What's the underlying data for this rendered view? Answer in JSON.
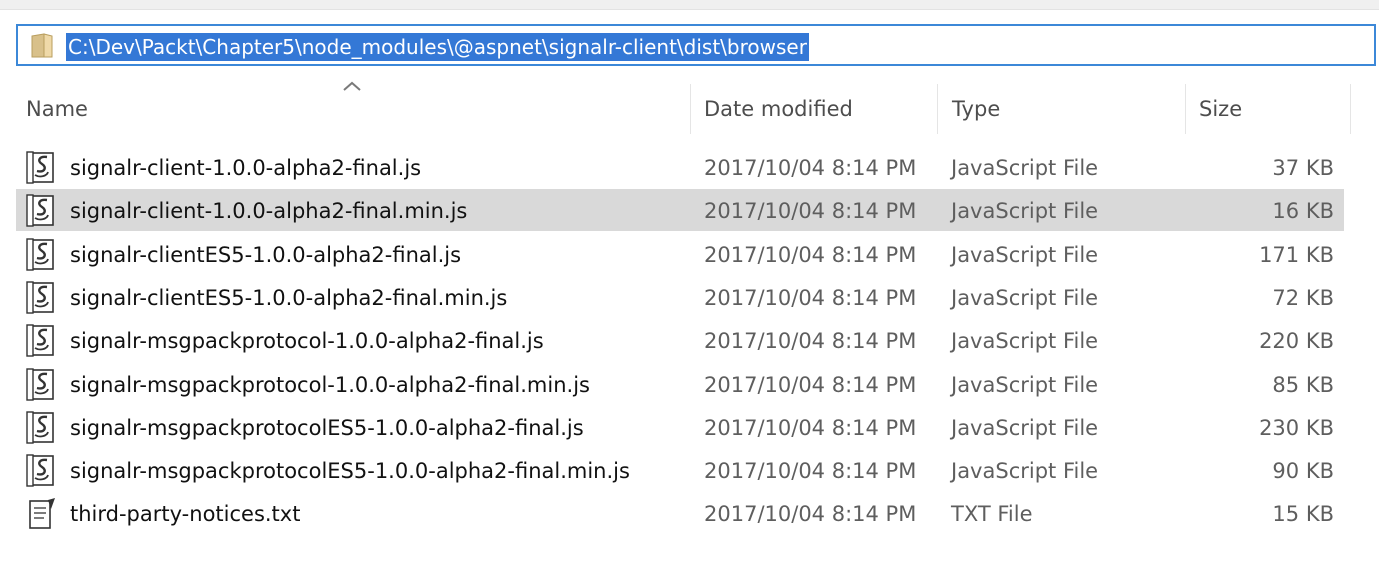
{
  "address": {
    "path": "C:\\Dev\\Packt\\Chapter5\\node_modules\\@aspnet\\signalr-client\\dist\\browser"
  },
  "columns": {
    "name": "Name",
    "date": "Date modified",
    "type": "Type",
    "size": "Size",
    "sorted_column": "Name",
    "sort_direction": "ascending"
  },
  "files": [
    {
      "name": "signalr-client-1.0.0-alpha2-final.js",
      "date": "2017/10/04 8:14 PM",
      "type": "JavaScript File",
      "size": "37 KB",
      "icon": "js-file-icon",
      "selected": false
    },
    {
      "name": "signalr-client-1.0.0-alpha2-final.min.js",
      "date": "2017/10/04 8:14 PM",
      "type": "JavaScript File",
      "size": "16 KB",
      "icon": "js-file-icon",
      "selected": true
    },
    {
      "name": "signalr-clientES5-1.0.0-alpha2-final.js",
      "date": "2017/10/04 8:14 PM",
      "type": "JavaScript File",
      "size": "171 KB",
      "icon": "js-file-icon",
      "selected": false
    },
    {
      "name": "signalr-clientES5-1.0.0-alpha2-final.min.js",
      "date": "2017/10/04 8:14 PM",
      "type": "JavaScript File",
      "size": "72 KB",
      "icon": "js-file-icon",
      "selected": false
    },
    {
      "name": "signalr-msgpackprotocol-1.0.0-alpha2-final.js",
      "date": "2017/10/04 8:14 PM",
      "type": "JavaScript File",
      "size": "220 KB",
      "icon": "js-file-icon",
      "selected": false
    },
    {
      "name": "signalr-msgpackprotocol-1.0.0-alpha2-final.min.js",
      "date": "2017/10/04 8:14 PM",
      "type": "JavaScript File",
      "size": "85 KB",
      "icon": "js-file-icon",
      "selected": false
    },
    {
      "name": "signalr-msgpackprotocolES5-1.0.0-alpha2-final.js",
      "date": "2017/10/04 8:14 PM",
      "type": "JavaScript File",
      "size": "230 KB",
      "icon": "js-file-icon",
      "selected": false
    },
    {
      "name": "signalr-msgpackprotocolES5-1.0.0-alpha2-final.min.js",
      "date": "2017/10/04 8:14 PM",
      "type": "JavaScript File",
      "size": "90 KB",
      "icon": "js-file-icon",
      "selected": false
    },
    {
      "name": "third-party-notices.txt",
      "date": "2017/10/04 8:14 PM",
      "type": "TXT File",
      "size": "15 KB",
      "icon": "txt-file-icon",
      "selected": false
    }
  ],
  "colors": {
    "address_border": "#3c88d8",
    "path_highlight": "#3478d6",
    "selected_row": "#d9d9d9"
  }
}
